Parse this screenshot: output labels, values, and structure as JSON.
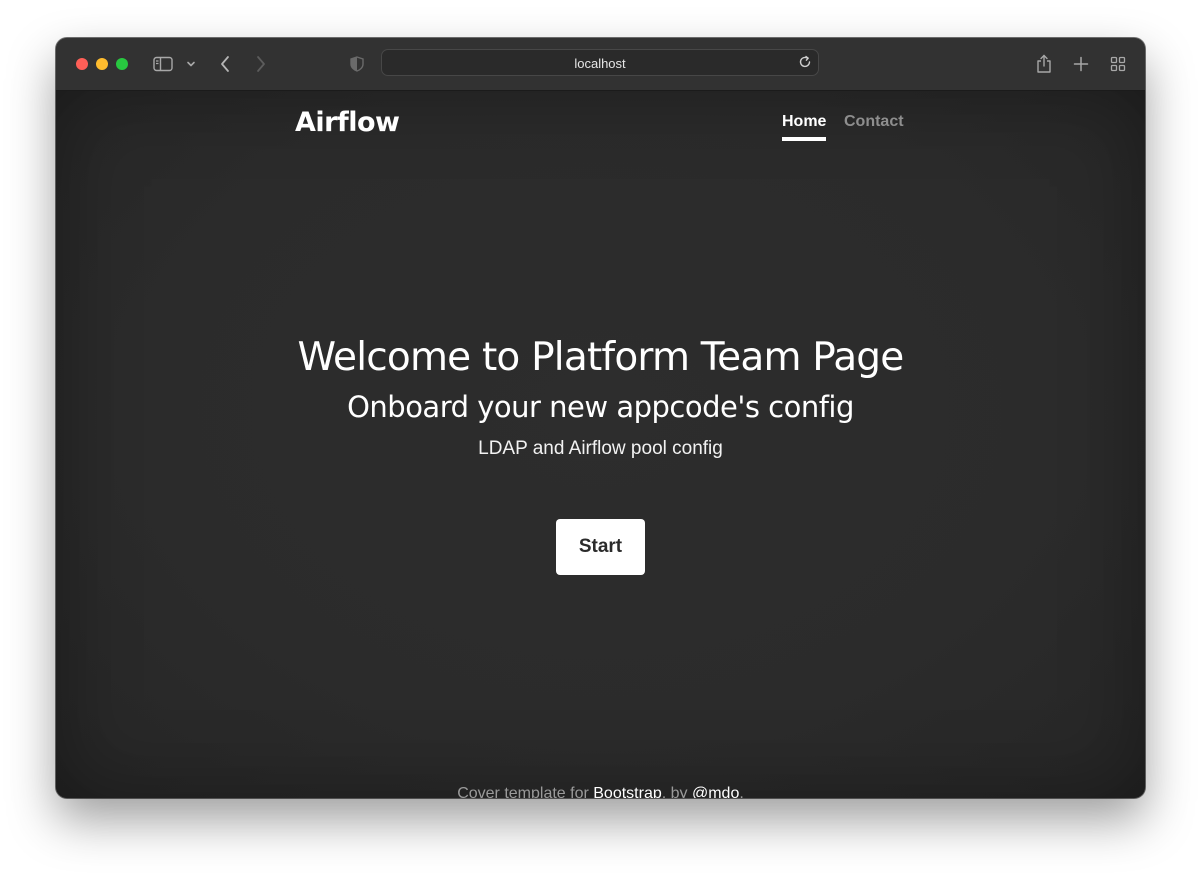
{
  "browser": {
    "address": "localhost"
  },
  "site": {
    "brand": "Airflow",
    "nav": [
      {
        "label": "Home",
        "active": true
      },
      {
        "label": "Contact",
        "active": false
      }
    ]
  },
  "hero": {
    "title": "Welcome to Platform Team Page",
    "subtitle": "Onboard your new appcode's config",
    "lead": "LDAP and Airflow pool config",
    "button": "Start"
  },
  "footer": {
    "prefix": "Cover template for ",
    "link1": "Bootstrap",
    "middle": ", by ",
    "link2": "@mdo",
    "suffix": "."
  },
  "colors": {
    "traffic_close": "#fe5f57",
    "traffic_min": "#febc2e",
    "traffic_max": "#28c840",
    "page_background": "#2b2b2b",
    "accent_text": "#ffffff",
    "muted_text": "#8e8e8e"
  },
  "icons": {
    "toolbar": [
      "sidebar-icon",
      "chevron-down-icon",
      "back-icon",
      "forward-icon",
      "shield-icon",
      "reload-icon",
      "share-icon",
      "plus-icon",
      "tab-overview-icon"
    ]
  }
}
